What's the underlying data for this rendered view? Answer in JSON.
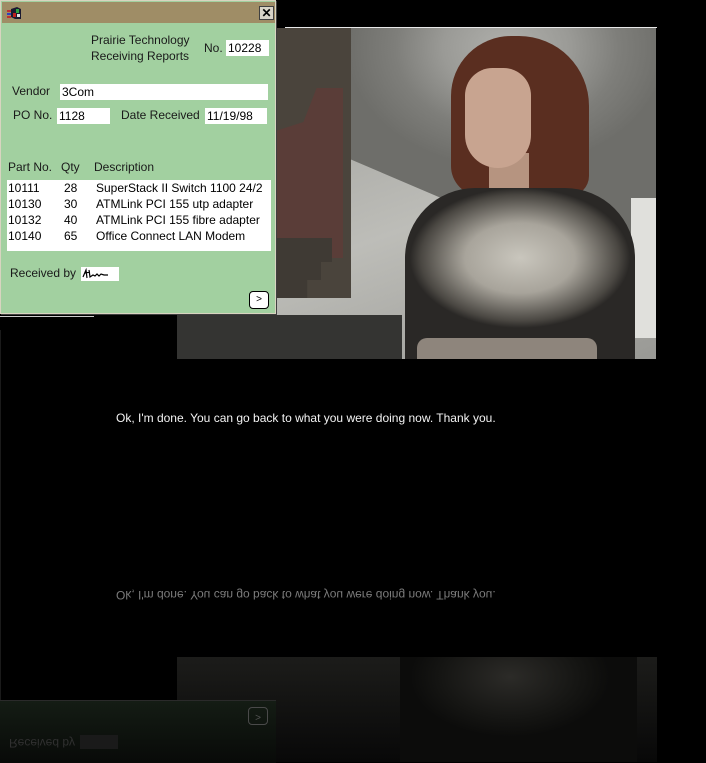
{
  "dialog": {
    "title_icon": "app-icon",
    "close_label": "✕",
    "company_line1": "Prairie Technology",
    "company_line2": "Receiving Reports",
    "number_label": "No.",
    "number_value": "10228",
    "vendor_label": "Vendor",
    "vendor_value": "3Com",
    "po_label": "PO No.",
    "po_value": "1128",
    "date_label": "Date Received",
    "date_value": "11/19/98",
    "columns": [
      "Part No.",
      "Qty",
      "Description"
    ],
    "rows": [
      {
        "part": "10111",
        "qty": "28",
        "desc": "SuperStack II Switch 1100 24/2"
      },
      {
        "part": "10130",
        "qty": "30",
        "desc": "ATMLink PCI 155 utp adapter"
      },
      {
        "part": "10132",
        "qty": "40",
        "desc": "ATMLink PCI 155 fibre adapter"
      },
      {
        "part": "10140",
        "qty": "65",
        "desc": "Office Connect LAN Modem"
      }
    ],
    "received_by_label": "Received by",
    "signature": "signature-image",
    "next_label": ">"
  },
  "message": "Ok, I'm done. You can go back to what you were doing now.  Thank you.",
  "colors": {
    "dialog_bg": "#a2d0a0",
    "titlebar": "#9f8d66",
    "background": "#000000"
  }
}
